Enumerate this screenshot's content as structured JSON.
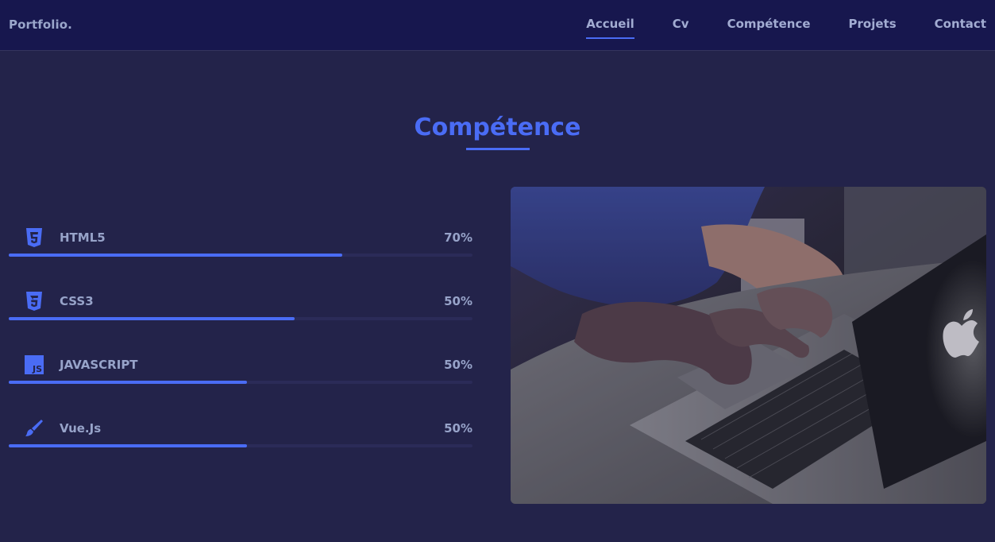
{
  "navbar": {
    "brand": "Portfolio.",
    "links": [
      {
        "label": "Accueil",
        "active": true
      },
      {
        "label": "Cv",
        "active": false
      },
      {
        "label": "Compétence",
        "active": false
      },
      {
        "label": "Projets",
        "active": false
      },
      {
        "label": "Contact",
        "active": false
      }
    ]
  },
  "section": {
    "title": "Compétence"
  },
  "skills": [
    {
      "name": "HTML5",
      "percent_label": "70%",
      "level": 0.72,
      "icon": "html5-icon"
    },
    {
      "name": "CSS3",
      "percent_label": "50%",
      "level": 0.617,
      "icon": "css3-icon"
    },
    {
      "name": "JAVASCRIPT",
      "percent_label": "50%",
      "level": 0.514,
      "icon": "javascript-icon"
    },
    {
      "name": "Vue.Js",
      "percent_label": "50%",
      "level": 0.514,
      "icon": "paint-brush-icon"
    }
  ],
  "colors": {
    "accent": "#4a6cf5",
    "background": "#23234a",
    "navbar": "#17174e",
    "text_muted": "#97a3c9"
  },
  "photo": {
    "subject": "hands-typing-on-laptop"
  }
}
